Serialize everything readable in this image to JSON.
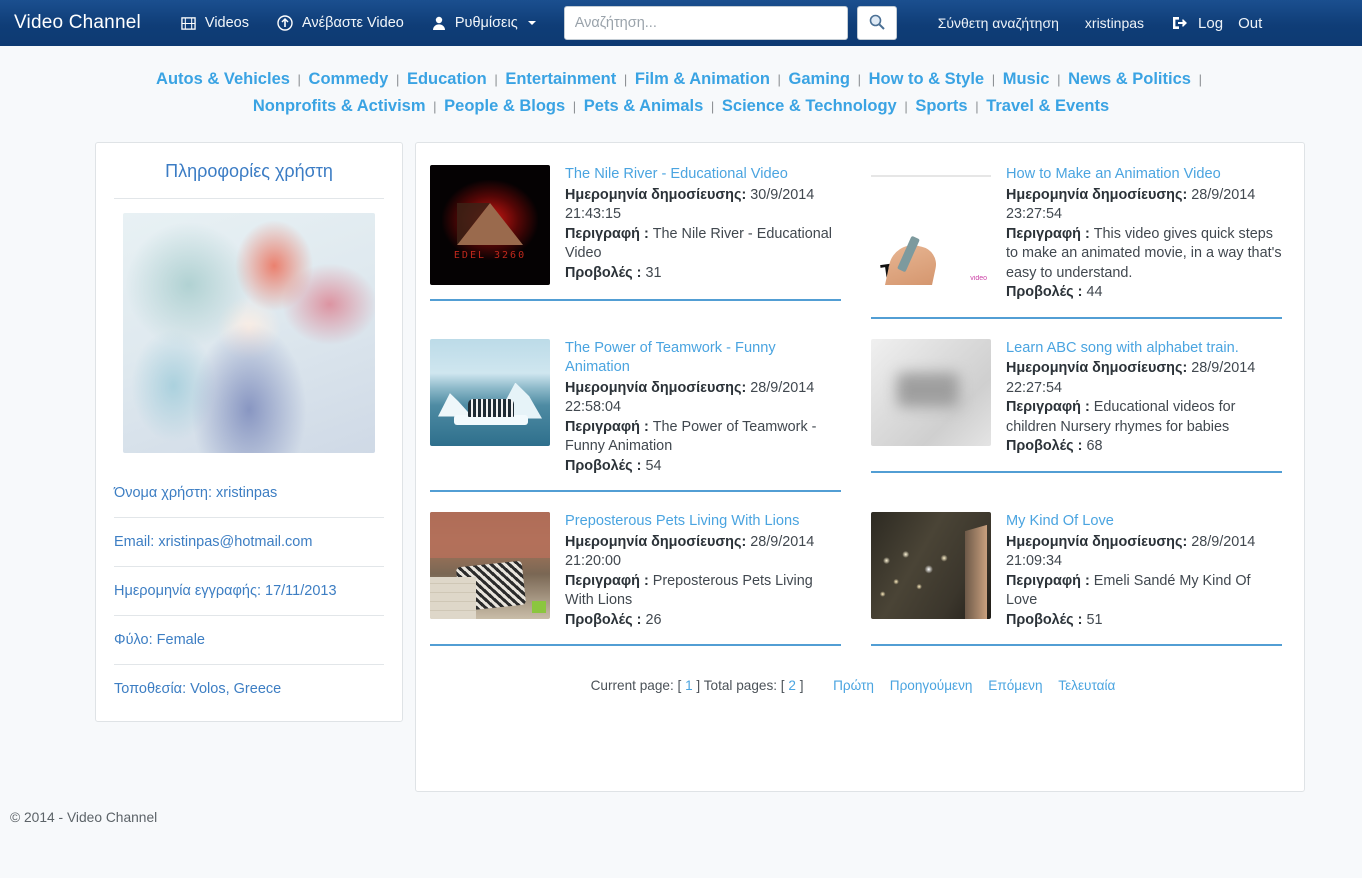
{
  "navbar": {
    "brand": "Video Channel",
    "videos_label": "Videos",
    "upload_label": "Ανέβαστε  Video",
    "settings_label": "Ρυθμίσεις",
    "advanced_search": "Σύνθετη αναζήτηση",
    "username": "xristinpas",
    "logout_word1": "Log",
    "logout_word2": "Out",
    "accent": "#0f3d77"
  },
  "search": {
    "placeholder": "Αναζήτηση...",
    "value": "",
    "button_icon": "search-icon"
  },
  "categories": [
    "Autos & Vehicles",
    "Commedy",
    "Education",
    "Entertainment",
    "Film & Animation",
    "Gaming",
    "How to & Style",
    "Music",
    "News & Politics",
    "Nonprofits & Activism",
    "People & Blogs",
    "Pets & Animals",
    "Science & Technology",
    "Sports",
    "Travel & Events"
  ],
  "sidebar": {
    "title": "Πληροφορίες χρήστη",
    "avatar_alt": "user-avatar",
    "rows": [
      "Όνομα χρήστη: xristinpas",
      "Email: xristinpas@hotmail.com",
      "Ημερομηνία εγγραφής: 17/11/2013",
      "Φύλο: Female",
      "Τοποθεσία: Volos, Greece"
    ]
  },
  "labels": {
    "date": "Ημερομηνία δημοσίευσης:",
    "description": "Περιγραφή :",
    "views": "Προβολές :"
  },
  "videos": [
    {
      "title": "The Nile River - Educational Video",
      "date": "30/9/2014 21:43:15",
      "description": "The Nile River - Educational Video",
      "views": "31",
      "thumb": "th-nile"
    },
    {
      "title": "How to Make an Animation Video",
      "date": "28/9/2014 23:27:54",
      "description": "This video gives quick steps to make an animated movie, in a way that's easy to understand.",
      "views": "44",
      "thumb": "th-anim"
    },
    {
      "title": "The Power of Teamwork - Funny Animation",
      "date": "28/9/2014 22:58:04",
      "description": "The Power of Teamwork - Funny Animation",
      "views": "54",
      "thumb": "th-peng"
    },
    {
      "title": "Learn ABC song with alphabet train.",
      "date": "28/9/2014 22:27:54",
      "description": "Educational videos for children Nursery rhymes for babies",
      "views": "68",
      "thumb": "th-abc"
    },
    {
      "title": "Preposterous Pets Living With Lions",
      "date": "28/9/2014 21:20:00",
      "description": "Preposterous Pets Living With Lions",
      "views": "26",
      "thumb": "th-pets"
    },
    {
      "title": "My Kind Of Love",
      "date": "28/9/2014 21:09:34",
      "description": "Emeli Sandé My Kind Of Love",
      "views": "51",
      "thumb": "th-love"
    }
  ],
  "pagination": {
    "current_label": "Current page: [",
    "current_value": "1",
    "current_close": "] Total pages: [",
    "total_value": "2",
    "total_close": "]",
    "first": "Πρώτη",
    "previous": "Προηγούμενη",
    "next": "Επόμενη",
    "last": "Τελευταία"
  },
  "footer": {
    "copyright": "© 2014 - Video Channel"
  }
}
